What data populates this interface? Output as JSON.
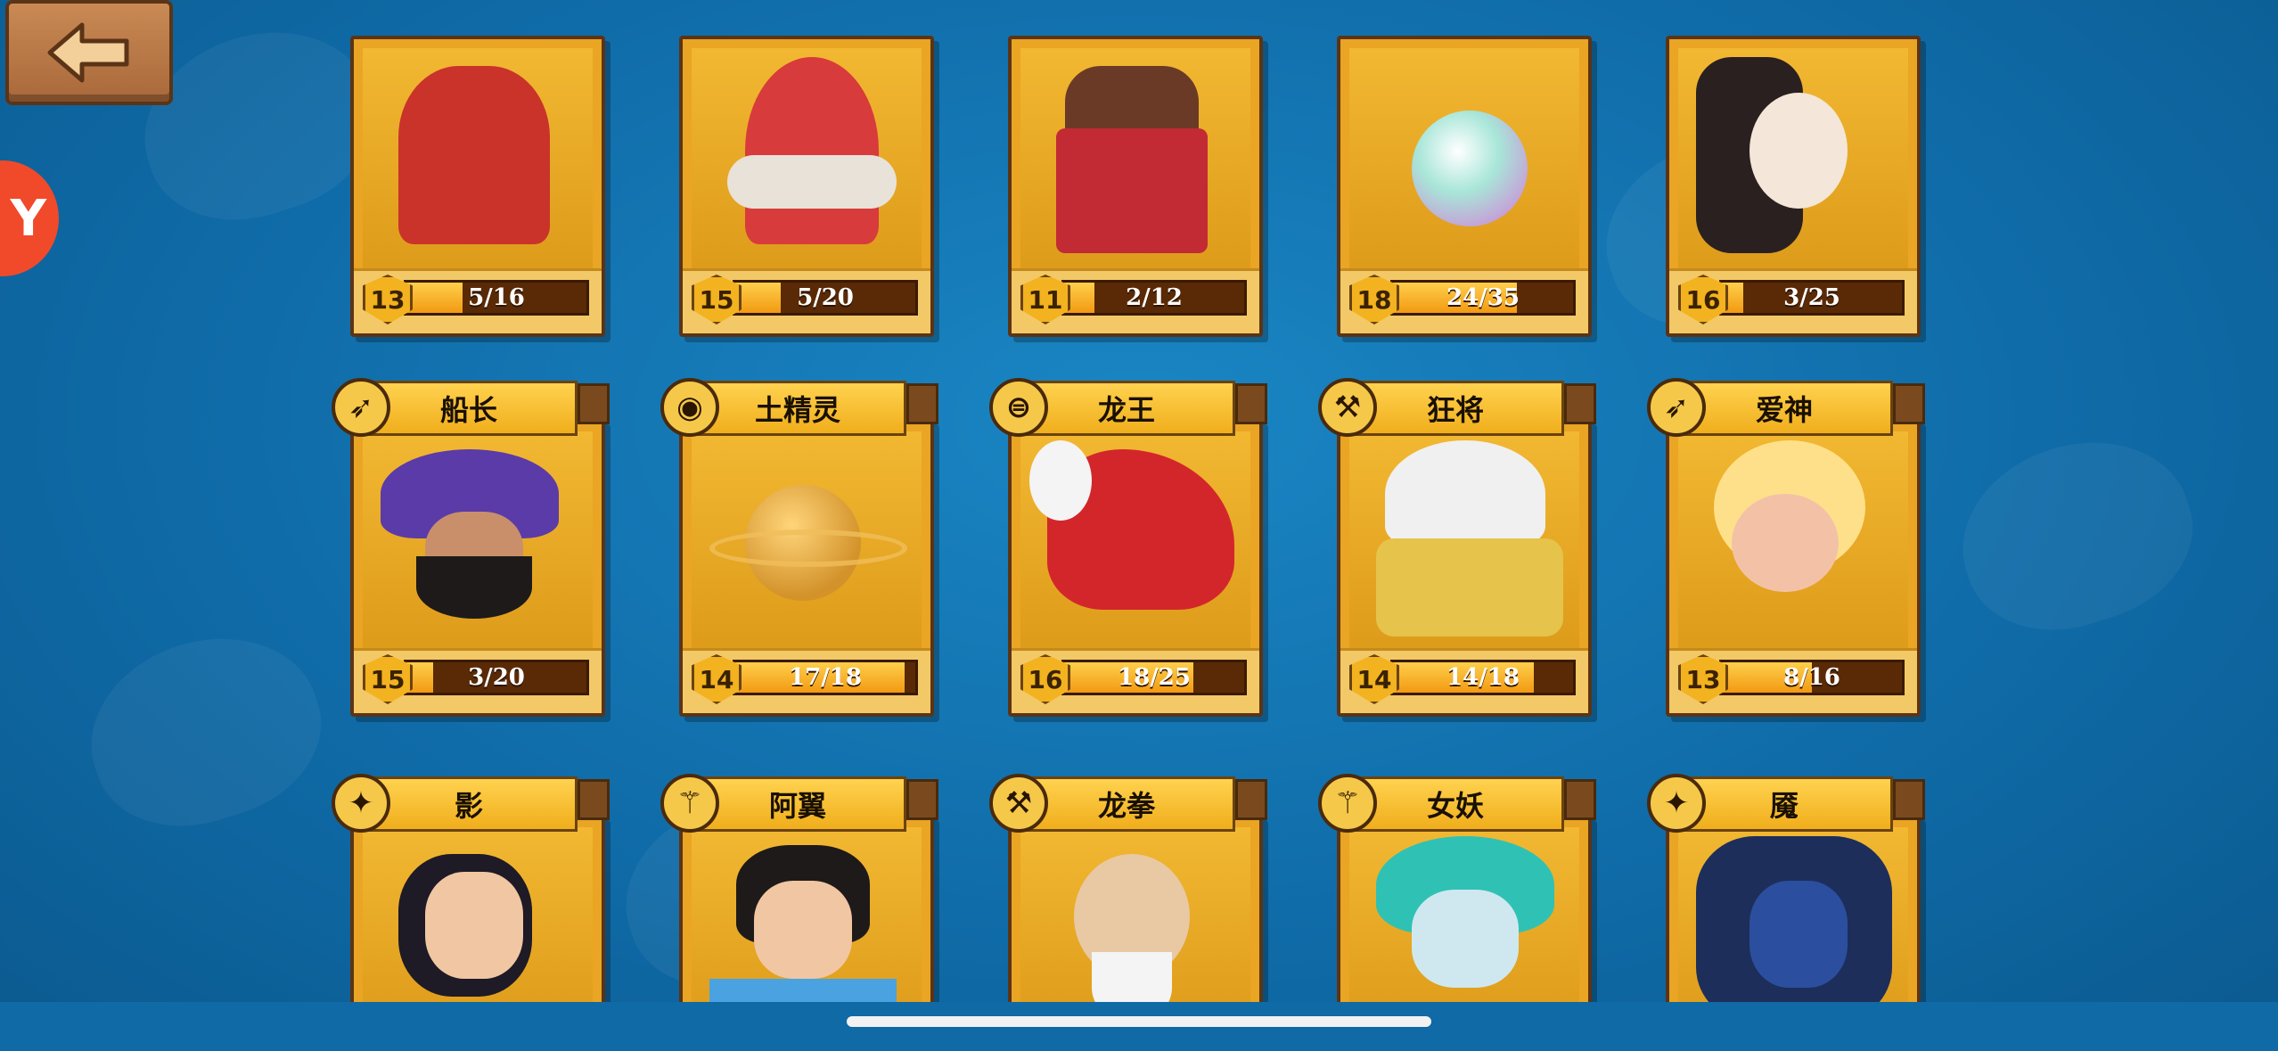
{
  "rows": [
    {
      "cards": [
        {
          "level": "13",
          "progress": "5/16",
          "ratio": 0.31,
          "accent": "#c9332a"
        },
        {
          "level": "15",
          "progress": "5/20",
          "ratio": 0.25,
          "accent": "#b0224a"
        },
        {
          "level": "11",
          "progress": "2/12",
          "ratio": 0.17,
          "accent": "#c22a34"
        },
        {
          "level": "18",
          "progress": "24/35",
          "ratio": 0.69,
          "accent": "#8fd9c8"
        },
        {
          "level": "16",
          "progress": "3/25",
          "ratio": 0.12,
          "accent": "#f4e6d8"
        }
      ]
    },
    {
      "cards": [
        {
          "name": "船长",
          "cls_icon": "bow-icon",
          "cls_glyph": "➶",
          "level": "15",
          "progress": "3/20",
          "ratio": 0.15,
          "accent": "#6b4fb8"
        },
        {
          "name": "土精灵",
          "cls_icon": "orb-icon",
          "cls_glyph": "◉",
          "level": "14",
          "progress": "17/18",
          "ratio": 0.94,
          "accent": "#d99a34"
        },
        {
          "name": "龙王",
          "cls_icon": "ring-icon",
          "cls_glyph": "⊜",
          "level": "16",
          "progress": "18/25",
          "ratio": 0.72,
          "accent": "#d3262b"
        },
        {
          "name": "狂将",
          "cls_icon": "axe-icon",
          "cls_glyph": "⚒",
          "level": "14",
          "progress": "14/18",
          "ratio": 0.78,
          "accent": "#f0f0f0"
        },
        {
          "name": "爱神",
          "cls_icon": "bow-icon",
          "cls_glyph": "➶",
          "level": "13",
          "progress": "8/16",
          "ratio": 0.5,
          "accent": "#ffe08a"
        }
      ]
    },
    {
      "cards": [
        {
          "name": "影",
          "cls_icon": "shuriken-icon",
          "cls_glyph": "✦",
          "accent": "#3a2c5e"
        },
        {
          "name": "阿翼",
          "cls_icon": "staff-icon",
          "cls_glyph": "⚚",
          "accent": "#4aa3e0"
        },
        {
          "name": "龙拳",
          "cls_icon": "axe-icon",
          "cls_glyph": "⚒",
          "accent": "#e8c9a4"
        },
        {
          "name": "女妖",
          "cls_icon": "staff-icon",
          "cls_glyph": "⚚",
          "accent": "#2fc2b4"
        },
        {
          "name": "魇",
          "cls_icon": "shuriken-icon",
          "cls_glyph": "✦",
          "accent": "#2b4f9e"
        }
      ]
    }
  ],
  "side_badge_text": "Y"
}
